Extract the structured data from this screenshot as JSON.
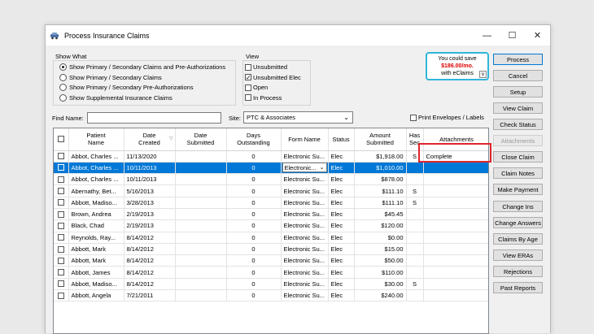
{
  "window": {
    "title": "Process Insurance Claims",
    "controls": {
      "minimize": "—",
      "maximize": "☐",
      "close": "✕"
    }
  },
  "show_what": {
    "label": "Show What",
    "options": [
      {
        "label": "Show Primary / Secondary Claims and Pre-Authorizations",
        "selected": true
      },
      {
        "label": "Show Primary / Secondary Claims",
        "selected": false
      },
      {
        "label": "Show Primary / Secondary Pre-Authorizations",
        "selected": false
      },
      {
        "label": "Show Supplemental Insurance Claims",
        "selected": false
      }
    ]
  },
  "view": {
    "label": "View",
    "options": [
      {
        "label": "Unsubmitted",
        "checked": false
      },
      {
        "label": "Unsubmitted Elec",
        "checked": true
      },
      {
        "label": "Open",
        "checked": false
      },
      {
        "label": "In Process",
        "checked": false
      }
    ]
  },
  "promo": {
    "line1": "You could save",
    "price": "$186.00/mo.",
    "line3": "with eClaims",
    "caret": "v"
  },
  "buttons": [
    {
      "label": "Process",
      "state": "primary"
    },
    {
      "label": "Cancel",
      "state": "normal"
    },
    {
      "label": "Setup",
      "state": "normal"
    },
    {
      "label": "View Claim",
      "state": "normal"
    },
    {
      "label": "Check Status",
      "state": "normal"
    },
    {
      "label": "Attachments",
      "state": "disabled"
    },
    {
      "label": "Close Claim",
      "state": "normal"
    },
    {
      "label": "Claim Notes",
      "state": "normal"
    },
    {
      "label": "Make Payment",
      "state": "normal"
    },
    {
      "label": "Change Ins",
      "state": "normal"
    },
    {
      "label": "Change Answers",
      "state": "normal"
    },
    {
      "label": "Claims By Age",
      "state": "normal"
    },
    {
      "label": "View ERAs",
      "state": "normal"
    },
    {
      "label": "Rejections",
      "state": "normal"
    },
    {
      "label": "Past Reports",
      "state": "normal"
    }
  ],
  "filters": {
    "find_label": "Find Name:",
    "find_value": "",
    "site_label": "Site:",
    "site_value": "PTC & Associates",
    "print_label": "Print Envelopes / Labels"
  },
  "table": {
    "columns": [
      "Patient\nName",
      "Date\nCreated",
      "Date\nSubmitted",
      "Days\nOutstanding",
      "Form Name",
      "Status",
      "Amount\nSubmitted",
      "Has\nSec",
      "Attachments"
    ],
    "rows": [
      {
        "patient": "Abbot, Charles ...",
        "created": "11/13/2020",
        "submitted": "",
        "days": "0",
        "form": "Electronic Su...",
        "status": "Elec",
        "amount": "$1,918.00",
        "sec": "S",
        "attach": "Complete",
        "selected": false
      },
      {
        "patient": "Abbot, Charles ...",
        "created": "10/11/2013",
        "submitted": "",
        "days": "0",
        "form": "Electronic...",
        "status": "Elec",
        "amount": "$1,010.00",
        "sec": "",
        "attach": "",
        "selected": true
      },
      {
        "patient": "Abbot, Charles ...",
        "created": "10/11/2013",
        "submitted": "",
        "days": "0",
        "form": "Electronic Su...",
        "status": "Elec",
        "amount": "$878.00",
        "sec": "",
        "attach": "",
        "selected": false
      },
      {
        "patient": "Abernathy, Bet...",
        "created": "5/16/2013",
        "submitted": "",
        "days": "0",
        "form": "Electronic Su...",
        "status": "Elec",
        "amount": "$111.10",
        "sec": "S",
        "attach": "",
        "selected": false
      },
      {
        "patient": "Abbott, Madiso...",
        "created": "3/28/2013",
        "submitted": "",
        "days": "0",
        "form": "Electronic Su...",
        "status": "Elec",
        "amount": "$111.10",
        "sec": "S",
        "attach": "",
        "selected": false
      },
      {
        "patient": "Brown, Andrea",
        "created": "2/19/2013",
        "submitted": "",
        "days": "0",
        "form": "Electronic Su...",
        "status": "Elec",
        "amount": "$45.45",
        "sec": "",
        "attach": "",
        "selected": false
      },
      {
        "patient": "Black, Chad",
        "created": "2/19/2013",
        "submitted": "",
        "days": "0",
        "form": "Electronic Su...",
        "status": "Elec",
        "amount": "$120.00",
        "sec": "",
        "attach": "",
        "selected": false
      },
      {
        "patient": "Reynolds, Ray...",
        "created": "8/14/2012",
        "submitted": "",
        "days": "0",
        "form": "Electronic Su...",
        "status": "Elec",
        "amount": "$0.00",
        "sec": "",
        "attach": "",
        "selected": false
      },
      {
        "patient": "Abbott, Mark",
        "created": "8/14/2012",
        "submitted": "",
        "days": "0",
        "form": "Electronic Su...",
        "status": "Elec",
        "amount": "$15.00",
        "sec": "",
        "attach": "",
        "selected": false
      },
      {
        "patient": "Abbott, Mark",
        "created": "8/14/2012",
        "submitted": "",
        "days": "0",
        "form": "Electronic Su...",
        "status": "Elec",
        "amount": "$50.00",
        "sec": "",
        "attach": "",
        "selected": false
      },
      {
        "patient": "Abbott, James",
        "created": "8/14/2012",
        "submitted": "",
        "days": "0",
        "form": "Electronic Su...",
        "status": "Elec",
        "amount": "$110.00",
        "sec": "",
        "attach": "",
        "selected": false
      },
      {
        "patient": "Abbott, Madiso...",
        "created": "8/14/2012",
        "submitted": "",
        "days": "0",
        "form": "Electronic Su...",
        "status": "Elec",
        "amount": "$30.00",
        "sec": "S",
        "attach": "",
        "selected": false
      },
      {
        "patient": "Abbott, Angela",
        "created": "7/21/2011",
        "submitted": "",
        "days": "0",
        "form": "Electronic Su...",
        "status": "Elec",
        "amount": "$240.00",
        "sec": "",
        "attach": "",
        "selected": false
      }
    ]
  },
  "colors": {
    "selection": "#0078d7",
    "promo_border": "#30b6d9",
    "promo_price": "#dd0000",
    "highlight": "#e0242b"
  }
}
